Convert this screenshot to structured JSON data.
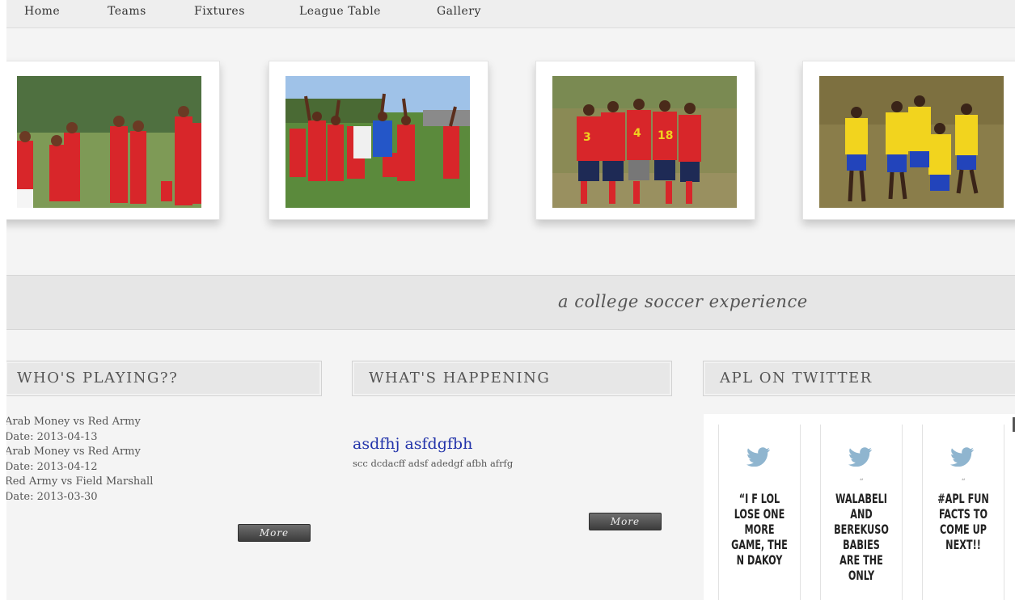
{
  "nav": {
    "items": [
      "Home",
      "Teams",
      "Fixtures",
      "League Table",
      "Gallery"
    ]
  },
  "gallery": {
    "photos": [
      {
        "icon": "team-photo-red-squad"
      },
      {
        "icon": "team-photo-red-celebration"
      },
      {
        "icon": "team-photo-red-huddle"
      },
      {
        "icon": "team-photo-yellow-squad"
      }
    ]
  },
  "tagline": "a college soccer experience",
  "sections": {
    "whos_playing": {
      "title": "WHO'S PLAYING??",
      "fixtures": [
        {
          "match": "Arab Money vs Red Army",
          "date": "Date: 2013-04-13"
        },
        {
          "match": "Arab Money vs Red Army",
          "date": "Date: 2013-04-12"
        },
        {
          "match": "Red Army vs Field Marshall",
          "date": "Date: 2013-03-30"
        }
      ],
      "more_label": "More"
    },
    "whats_happening": {
      "title": "WHAT'S HAPPENING",
      "news_title": "asdfhj asfdgfbh",
      "news_body": "scc dcdacff  adsf adedgf afbh afrfg",
      "more_label": "More"
    },
    "twitter": {
      "title": "APL ON TWITTER",
      "tweets": [
        {
          "quote": "",
          "text": "“I F LOL LOSE ONE MORE GAME, THE N DAKOY"
        },
        {
          "quote": "“",
          "text": "WALABELI AND BEREKUSO BABIES ARE THE ONLY"
        },
        {
          "quote": "“",
          "text": "#APL FUN FACTS TO COME UP NEXT!!"
        }
      ],
      "accent_color": "#8fb5cf"
    }
  },
  "colors": {
    "page_bg": "#f4f4f4",
    "link_blue": "#2233aa",
    "band_bg": "#e6e6e6"
  }
}
